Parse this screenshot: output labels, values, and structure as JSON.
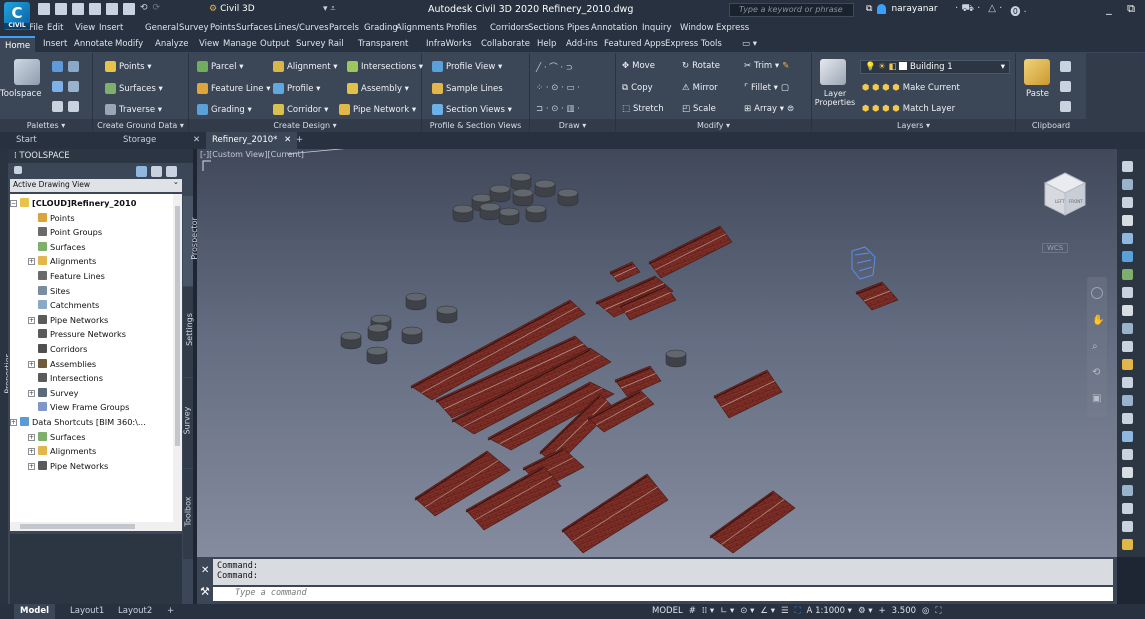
{
  "titlebar": {
    "workspace": "Civil 3D",
    "title": "Autodesk Civil 3D 2020   Refinery_2010.dwg",
    "search_placeholder": "Type a keyword or phrase",
    "user": "narayanar"
  },
  "menu": [
    "File",
    "Edit",
    "View",
    "Insert",
    "General",
    "Survey",
    "Points",
    "Surfaces",
    "Lines/Curves",
    "Parcels",
    "Grading",
    "Alignments",
    "Profiles",
    "Corridors",
    "Sections",
    "Pipes",
    "Annotation",
    "Inquiry",
    "Window",
    "Express"
  ],
  "ribbon_tabs": [
    "Home",
    "Insert",
    "Annotate",
    "Modify",
    "Analyze",
    "View",
    "Manage",
    "Output",
    "Survey",
    "Rail",
    "Transparent",
    "InfraWorks",
    "Collaborate",
    "Help",
    "Add-ins",
    "Featured Apps",
    "Express Tools"
  ],
  "ribbon": {
    "palettes": {
      "title": "Palettes ▾",
      "toolspace": "Toolspace"
    },
    "ground": {
      "title": "Create Ground Data ▾",
      "points": "Points ▾",
      "surfaces": "Surfaces ▾",
      "traverse": "Traverse ▾"
    },
    "design": {
      "title": "Create Design ▾",
      "parcel": "Parcel ▾",
      "feature_line": "Feature Line ▾",
      "grading": "Grading ▾",
      "alignment": "Alignment ▾",
      "profile": "Profile ▾",
      "corridor": "Corridor ▾",
      "intersections": "Intersections ▾",
      "assembly": "Assembly ▾",
      "pipe_network": "Pipe Network ▾"
    },
    "profile_section": {
      "title": "Profile & Section Views",
      "profile_view": "Profile View ▾",
      "sample_lines": "Sample Lines",
      "section_views": "Section Views ▾"
    },
    "draw": {
      "title": "Draw ▾"
    },
    "modify": {
      "title": "Modify ▾",
      "move": "Move",
      "copy": "Copy",
      "stretch": "Stretch",
      "rotate": "Rotate",
      "mirror": "Mirror",
      "scale": "Scale",
      "trim": "Trim ▾",
      "fillet": "Fillet ▾",
      "array": "Array ▾"
    },
    "layers": {
      "title": "Layers ▾",
      "layer_properties": "Layer Properties",
      "current_layer": "Building 1",
      "make_current": "Make Current",
      "match_layer": "Match Layer"
    },
    "clipboard": {
      "title": "Clipboard",
      "paste": "Paste"
    }
  },
  "doc_tabs": {
    "start": "Start",
    "storage": "Storage",
    "drawing": "Refinery_2010*"
  },
  "toolspace": {
    "header": "TOOLSPACE",
    "view_select": "Active Drawing View",
    "tabs": {
      "prospector": "Prospector",
      "settings": "Settings",
      "survey": "Survey",
      "toolbox": "Toolbox"
    },
    "properties": "Properties",
    "tree": [
      {
        "label": "[CLOUD]Refinery_2010",
        "bold": true
      },
      {
        "label": "Points"
      },
      {
        "label": "Point Groups"
      },
      {
        "label": "Surfaces"
      },
      {
        "label": "Alignments"
      },
      {
        "label": "Feature Lines"
      },
      {
        "label": "Sites"
      },
      {
        "label": "Catchments"
      },
      {
        "label": "Pipe Networks"
      },
      {
        "label": "Pressure Networks"
      },
      {
        "label": "Corridors"
      },
      {
        "label": "Assemblies"
      },
      {
        "label": "Intersections"
      },
      {
        "label": "Survey"
      },
      {
        "label": "View Frame Groups"
      },
      {
        "label": "Data Shortcuts [BIM 360:\\..."
      },
      {
        "label": "Surfaces"
      },
      {
        "label": "Alignments"
      },
      {
        "label": "Pipe Networks"
      }
    ]
  },
  "viewport": {
    "label": "[-][Custom View][Current]",
    "wcs": "WCS",
    "viewcube": {
      "left": "LEFT",
      "front": "FRONT"
    }
  },
  "command": {
    "history": [
      "Command:",
      "Command:"
    ],
    "placeholder": "Type a command"
  },
  "statusbar": {
    "layouts": [
      "Model",
      "Layout1",
      "Layout2"
    ],
    "mode": "MODEL",
    "scale": "1:1000 ▾",
    "value": "3.500"
  },
  "colors": {
    "accent": "#3aa0ff",
    "roof": "#7d2e26",
    "viewport_top": "#40485a",
    "viewport_bottom": "#868ca0"
  }
}
